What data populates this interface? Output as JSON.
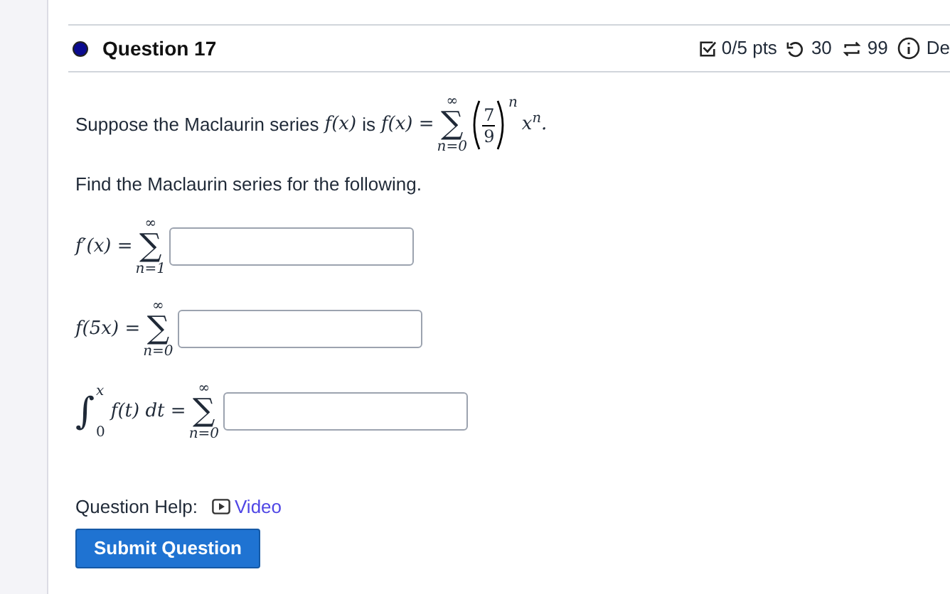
{
  "question": {
    "title": "Question 17",
    "points": "0/5 pts",
    "attempts": "30",
    "retries": "99",
    "details": "De"
  },
  "intro": {
    "text": "Suppose the Maclaurin series",
    "f": "f(x)",
    "is": "is",
    "lhs": "f(x) =",
    "sigma": "∑",
    "upper": "∞",
    "lower": "n=0",
    "num": "7",
    "den": "9",
    "power": "n",
    "tail": "x$^{n}$."
  },
  "prompt": "Find the Maclaurin series for the following.",
  "parts": [
    {
      "kind": "plain",
      "lhs": "f′(x) =",
      "sigma": "∑",
      "upper": "∞",
      "lower": "n=1"
    },
    {
      "kind": "plain",
      "lhs": "f(5x) =",
      "sigma": "∑",
      "upper": "∞",
      "lower": "n=0"
    },
    {
      "kind": "integral",
      "integral": "∫",
      "int_upper": "x",
      "int_lower": "0",
      "lhs": "f(t) dt =",
      "sigma": "∑",
      "upper": "∞",
      "lower": "n=0"
    }
  ],
  "help": {
    "label": "Question Help:",
    "link": "Video"
  },
  "submit": "Submit Question"
}
